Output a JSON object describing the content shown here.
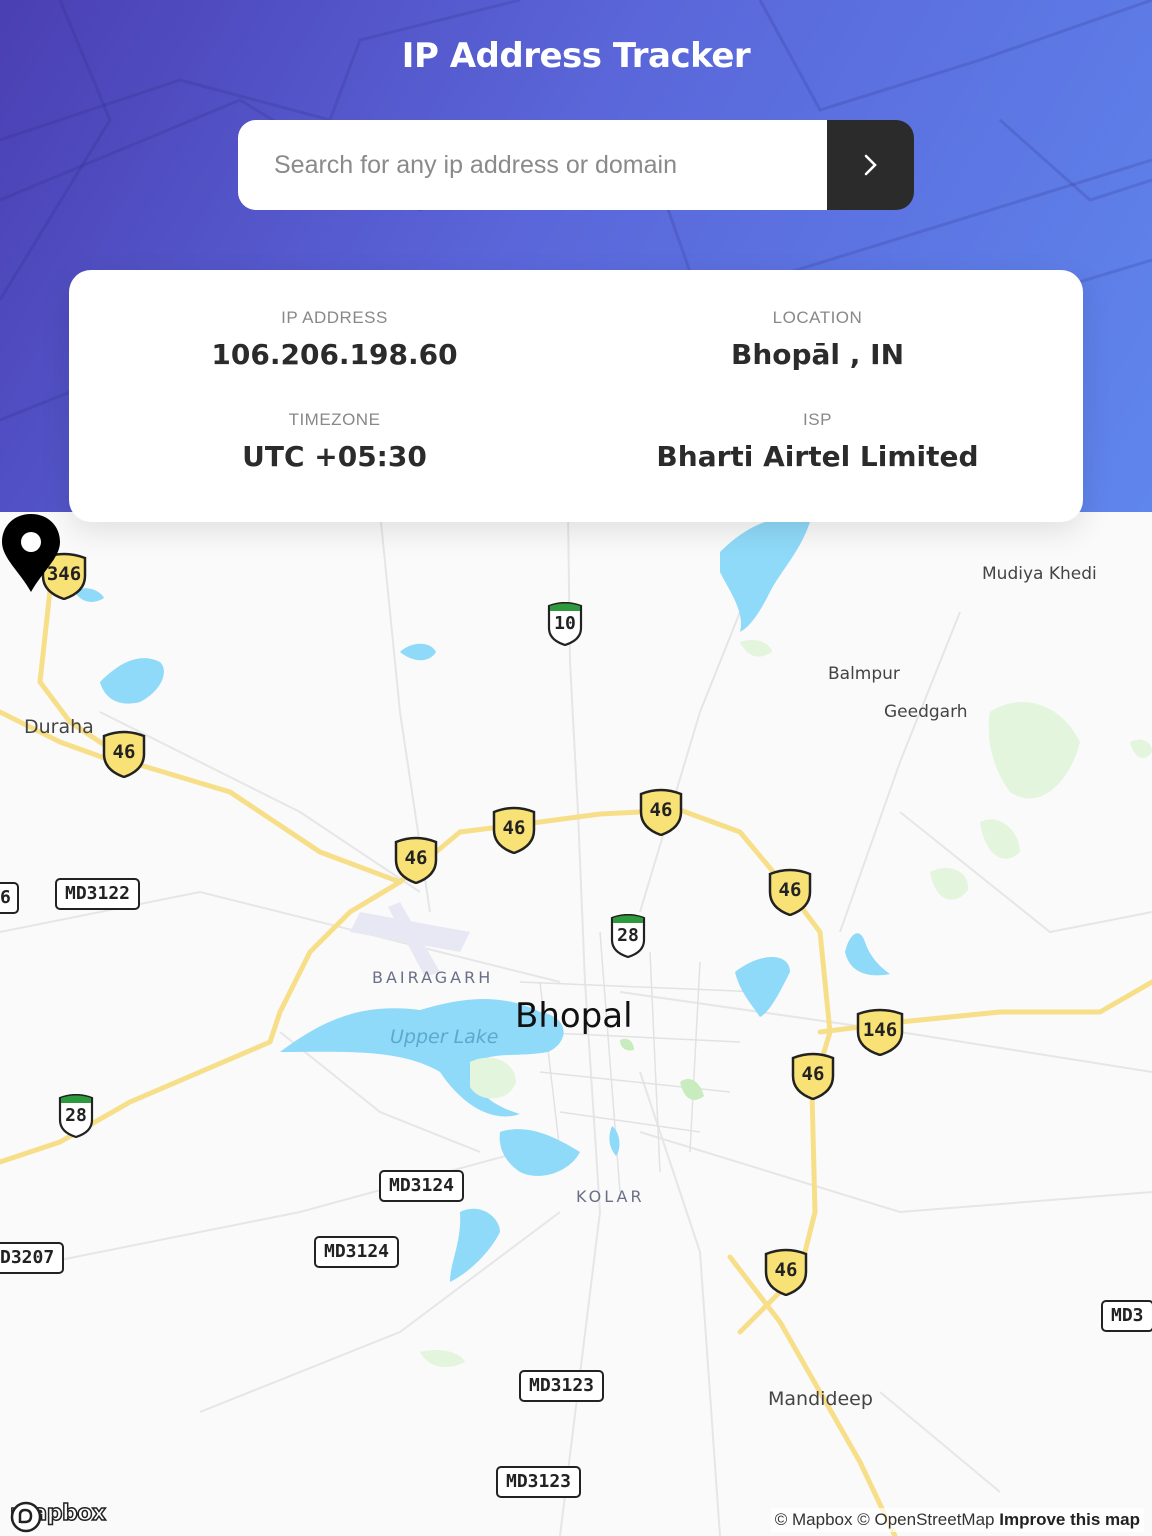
{
  "app": {
    "title": "IP Address Tracker"
  },
  "search": {
    "placeholder": "Search for any ip address or domain",
    "value": ""
  },
  "info": {
    "ip_label": "IP ADDRESS",
    "ip_value": "106.206.198.60",
    "location_label": "LOCATION",
    "location_value": "Bhopāl , IN",
    "timezone_label": "TIMEZONE",
    "timezone_value": "UTC +05:30",
    "isp_label": "ISP",
    "isp_value": "Bharti Airtel Limited"
  },
  "map": {
    "city": "Bhopal",
    "towns": [
      "Mudiya Khedi",
      "Balmpur",
      "Geedgarh",
      "Duraha",
      "Mandideep"
    ],
    "districts": [
      "BAIRAGARH",
      "KOLAR"
    ],
    "lake": "Upper Lake",
    "highway_shields": [
      "346",
      "46",
      "46",
      "46",
      "46",
      "46",
      "146",
      "46",
      "46"
    ],
    "nh_shields": [
      "10",
      "28",
      "28"
    ],
    "md_labels": [
      "MD3122",
      "MD3124",
      "MD3124",
      "D3207",
      "MD3123",
      "MD3123",
      "MD3",
      "6"
    ],
    "logo_text": "mapbox",
    "attribution": {
      "mapbox": "© Mapbox",
      "osm": "© OpenStreetMap",
      "improve": "Improve this map"
    }
  },
  "icons": {
    "submit": "chevron-right-icon",
    "marker": "location-pin-icon",
    "logo": "mapbox-logo-icon"
  },
  "colors": {
    "accent_dark": "#2b2b2b",
    "header_start": "#4a3fb3",
    "header_end": "#5f86ec",
    "water": "#8fdaf9",
    "highway": "#f7df8a",
    "shield": "#f9e275"
  }
}
